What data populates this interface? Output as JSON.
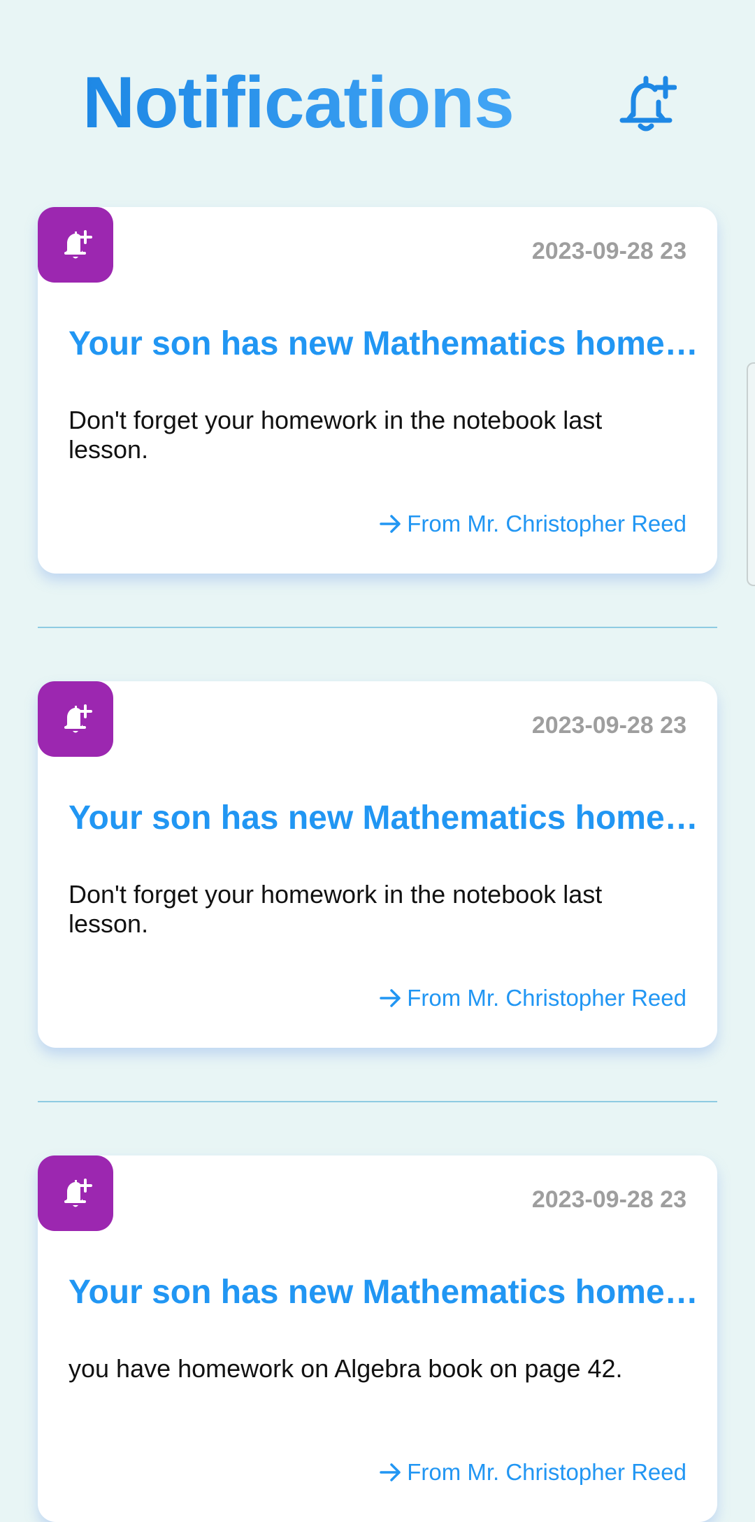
{
  "header": {
    "title": "Notifications",
    "action_icon": "bell-plus-icon"
  },
  "colors": {
    "background": "#e8f5f5",
    "accent": "#2196f3",
    "badge": "#9c27b0",
    "timestamp": "#9e9e9e",
    "divider": "#8ecbe2"
  },
  "notifications": [
    {
      "icon": "bell-plus-icon",
      "timestamp": "2023-09-28 23",
      "title": "Your son has new Mathematics homework",
      "body": "Don't forget your homework in the notebook last lesson.",
      "sender": "From Mr. Christopher Reed"
    },
    {
      "icon": "bell-plus-icon",
      "timestamp": "2023-09-28 23",
      "title": "Your son has new Mathematics homework",
      "body": "Don't forget your homework in the notebook last lesson.",
      "sender": "From Mr. Christopher Reed"
    },
    {
      "icon": "bell-plus-icon",
      "timestamp": "2023-09-28 23",
      "title": "Your son has new Mathematics homework",
      "body": "you have homework on Algebra book on page 42.",
      "sender": "From Mr. Christopher Reed"
    }
  ]
}
